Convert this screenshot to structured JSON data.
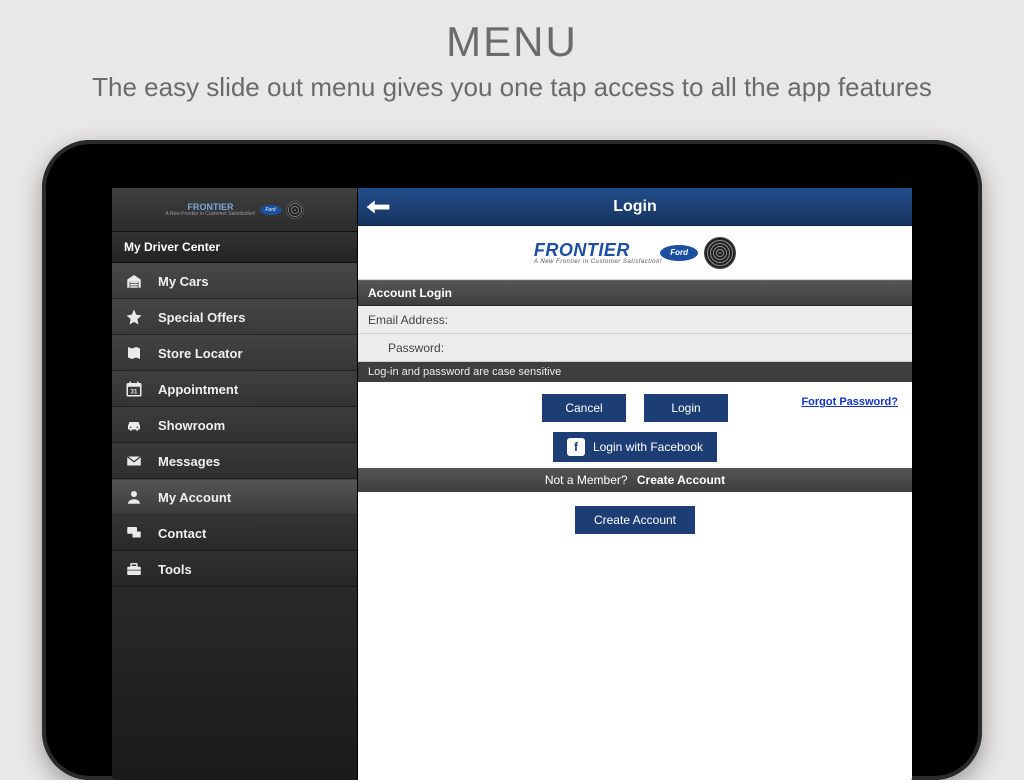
{
  "promo": {
    "title": "MENU",
    "subtitle": "The easy slide out menu gives you one tap access to all the app features"
  },
  "brand": {
    "name": "FRONTIER",
    "tagline": "A New Frontier in Customer Satisfaction!",
    "oval_text": "Ford"
  },
  "sidebar": {
    "header": "My Driver Center",
    "items": [
      {
        "label": "My Cars"
      },
      {
        "label": "Special Offers"
      },
      {
        "label": "Store Locator"
      },
      {
        "label": "Appointment"
      },
      {
        "label": "Showroom"
      },
      {
        "label": "Messages"
      },
      {
        "label": "My Account"
      },
      {
        "label": "Contact"
      },
      {
        "label": "Tools"
      }
    ],
    "active_index": 6
  },
  "titlebar": {
    "title": "Login"
  },
  "login": {
    "section_title": "Account Login",
    "email_label": "Email Address:",
    "password_label": "Password:",
    "hint": "Log-in and password are case sensitive",
    "cancel": "Cancel",
    "login": "Login",
    "forgot": "Forgot Password?",
    "facebook": "Login with Facebook",
    "not_member": "Not a Member?",
    "create_account_label": "Create Account",
    "create_account_button": "Create Account"
  }
}
